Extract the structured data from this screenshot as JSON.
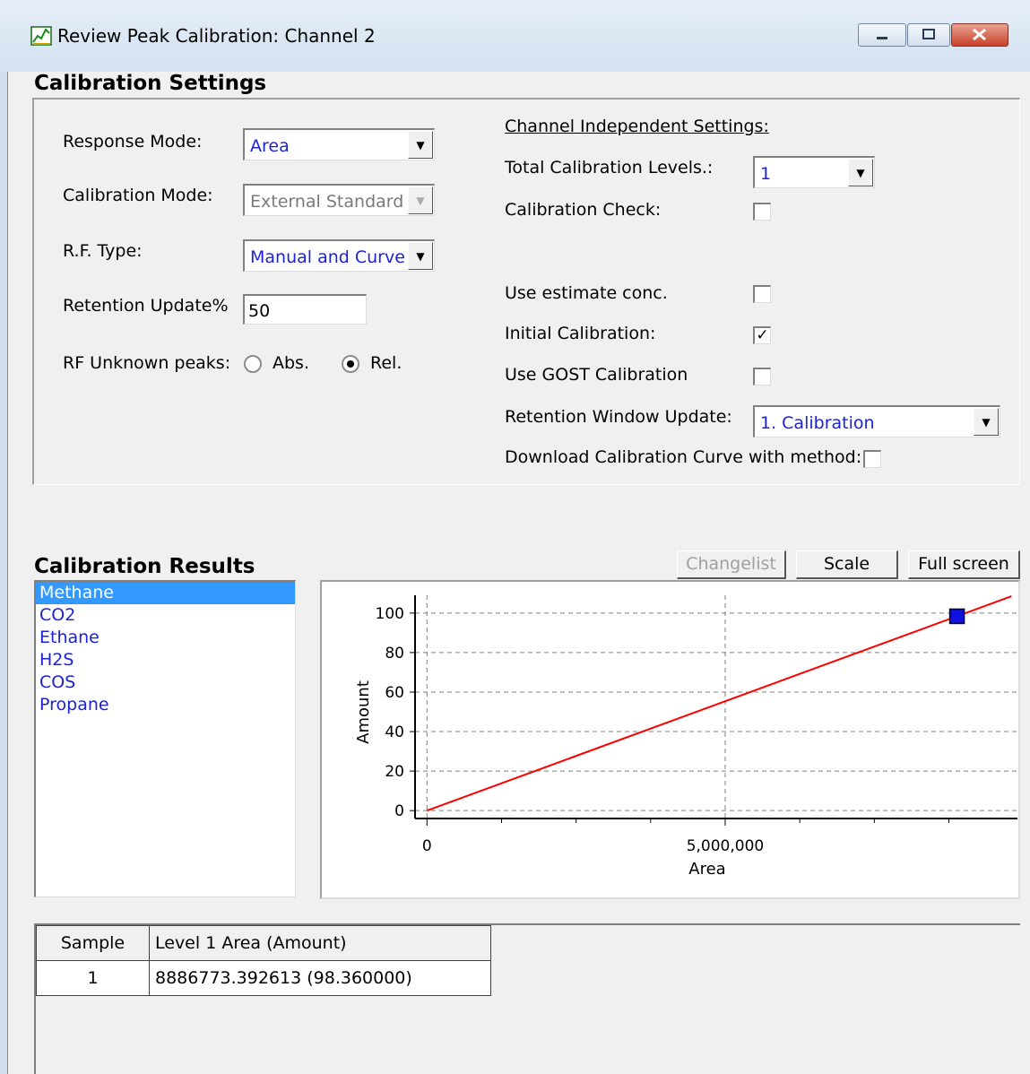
{
  "window": {
    "title": "Review Peak Calibration: Channel 2"
  },
  "calibration_settings": {
    "section_title": "Calibration Settings",
    "response_mode": {
      "label": "Response Mode:",
      "value": "Area"
    },
    "calibration_mode": {
      "label": "Calibration Mode:",
      "value": "External Standard",
      "enabled": false
    },
    "rf_type": {
      "label": "R.F. Type:",
      "value": "Manual and Curve"
    },
    "retention_update": {
      "label": "Retention Update%",
      "value": "50"
    },
    "rf_unknown_peaks": {
      "label": "RF Unknown peaks:",
      "abs_label": "Abs.",
      "rel_label": "Rel.",
      "selected": "Rel."
    },
    "channel_independent": {
      "heading": "Channel Independent Settings:",
      "total_levels": {
        "label": "Total Calibration Levels.:",
        "value": "1"
      },
      "calibration_check": {
        "label": "Calibration Check:",
        "checked": false
      },
      "use_estimate_conc": {
        "label": "Use estimate conc.",
        "checked": false
      },
      "initial_calibration": {
        "label": "Initial Calibration:",
        "checked": true,
        "mark": "✓"
      },
      "use_gost_calibration": {
        "label": "Use GOST Calibration",
        "checked": false
      },
      "retention_window_update": {
        "label": "Retention Window Update:",
        "value": "1. Calibration"
      },
      "download_curve": {
        "label": "Download Calibration Curve with method:",
        "checked": false
      }
    }
  },
  "calibration_results": {
    "section_title": "Calibration Results",
    "buttons": {
      "changelist": "Changelist",
      "scale": "Scale",
      "full_screen": "Full screen"
    },
    "peaks": [
      "Methane",
      "CO2",
      "Ethane",
      "H2S",
      "COS",
      "Propane"
    ],
    "selected_peak": "Methane"
  },
  "chart_data": {
    "type": "scatter",
    "xlabel": "Area",
    "ylabel": "Amount",
    "x_ticks": [
      0,
      5000000
    ],
    "x_tick_labels": [
      "0",
      "5,000,000"
    ],
    "y_ticks": [
      0,
      20,
      40,
      60,
      80,
      100
    ],
    "y_tick_labels": [
      "0",
      "20",
      "40",
      "60",
      "80",
      "100"
    ],
    "xlim": [
      -200000,
      9900000
    ],
    "ylim": [
      -4,
      109
    ],
    "grid": true,
    "points": [
      {
        "x": 8886773.392613,
        "y": 98.36
      }
    ],
    "fit_line": {
      "x": [
        0,
        9800000
      ],
      "y": [
        0,
        108.5
      ]
    },
    "point_color": "#1010e0",
    "line_color": "#ff0000"
  },
  "results_table": {
    "headers": [
      "Sample",
      "Level 1 Area (Amount)"
    ],
    "rows": [
      [
        "1",
        "8886773.392613 (98.360000)"
      ]
    ]
  }
}
